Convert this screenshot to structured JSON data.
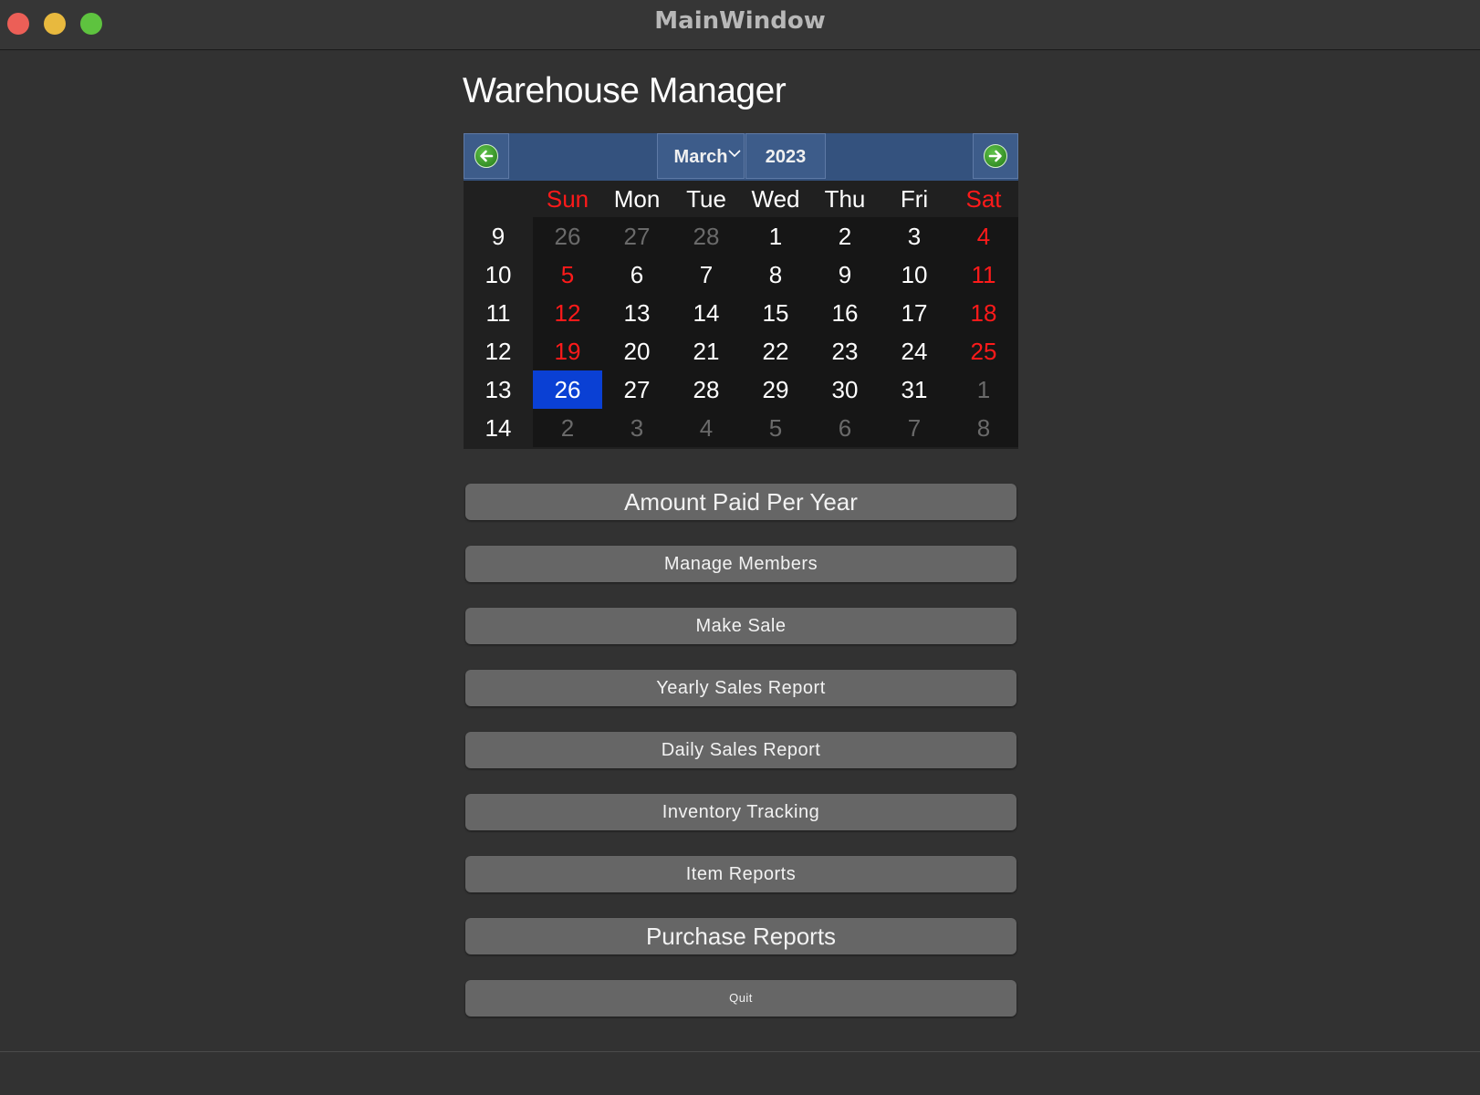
{
  "window": {
    "title": "MainWindow",
    "controls": [
      "close",
      "minimize",
      "maximize"
    ]
  },
  "app": {
    "title": "Warehouse Manager"
  },
  "calendar": {
    "month": "March",
    "year": "2023",
    "prev_icon": "arrow-left-icon",
    "next_icon": "arrow-right-icon",
    "weekday_headers": [
      "Sun",
      "Mon",
      "Tue",
      "Wed",
      "Thu",
      "Fri",
      "Sat"
    ],
    "weeks": [
      {
        "week": "9",
        "days": [
          "26",
          "27",
          "28",
          "1",
          "2",
          "3",
          "4"
        ]
      },
      {
        "week": "10",
        "days": [
          "5",
          "6",
          "7",
          "8",
          "9",
          "10",
          "11"
        ]
      },
      {
        "week": "11",
        "days": [
          "12",
          "13",
          "14",
          "15",
          "16",
          "17",
          "18"
        ]
      },
      {
        "week": "12",
        "days": [
          "19",
          "20",
          "21",
          "22",
          "23",
          "24",
          "25"
        ]
      },
      {
        "week": "13",
        "days": [
          "26",
          "27",
          "28",
          "29",
          "30",
          "31",
          "1"
        ]
      },
      {
        "week": "14",
        "days": [
          "2",
          "3",
          "4",
          "5",
          "6",
          "7",
          "8"
        ]
      }
    ],
    "selected_day": "26",
    "colors": {
      "nav_bg": "#34527e",
      "weekend": "#ff1a1a",
      "selected": "#0a40d4",
      "other_month": "#6a6a6a"
    }
  },
  "buttons": {
    "amount_paid": "Amount Paid Per Year",
    "manage_members": "Manage Members",
    "make_sale": "Make Sale",
    "yearly_sales": "Yearly Sales Report",
    "daily_sales": "Daily Sales Report",
    "inventory": "Inventory Tracking",
    "item_reports": "Item Reports",
    "purchase_reports": "Purchase Reports",
    "quit": "Quit"
  }
}
